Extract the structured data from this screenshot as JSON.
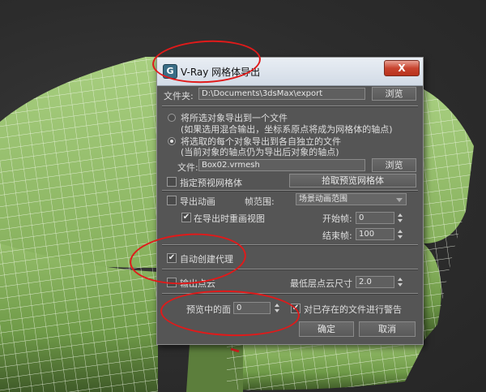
{
  "dialog": {
    "title": "V-Ray 网格体导出",
    "app_icon_glyph": "G",
    "close_glyph": "X",
    "folder": {
      "label": "文件夹:",
      "value": "D:\\Documents\\3dsMax\\export",
      "browse_label": "浏览"
    },
    "radio_single": {
      "line1": "将所选对象导出到一个文件",
      "line2": "(如果选用混合输出，坐标系原点将成为网格体的轴点)"
    },
    "radio_multi": {
      "line1": "将选取的每个对象导出到各自独立的文件",
      "line2": "(当前对象的轴点仍为导出后对象的轴点)"
    },
    "file": {
      "label": "文件:",
      "value": "Box02.vrmesh",
      "browse_label": "浏览"
    },
    "preview_mesh": {
      "label": "指定预视网格体",
      "button_label": "拾取预览网格体"
    },
    "animation": {
      "export_label": "导出动画",
      "range_label": "帧范围:",
      "range_value": "场景动画范围",
      "redraw_label": "在导出时重画视图",
      "start_label": "开始帧:",
      "start_value": "0",
      "end_label": "结束帧:",
      "end_value": "100"
    },
    "auto_proxy": {
      "label": "自动创建代理",
      "check": "✔"
    },
    "point_cloud": {
      "label": "输出点云",
      "min_size_label": "最低层点云尺寸",
      "min_size_value": "2.0"
    },
    "preview_faces": {
      "label": "预览中的面",
      "value": "0"
    },
    "warn_existing": {
      "label": "对已存在的文件进行警告",
      "check": "✔"
    },
    "ok_label": "确定",
    "cancel_label": "取消"
  },
  "colors": {
    "annotation": "#e01a1a",
    "mesh": "#9cc46f"
  }
}
